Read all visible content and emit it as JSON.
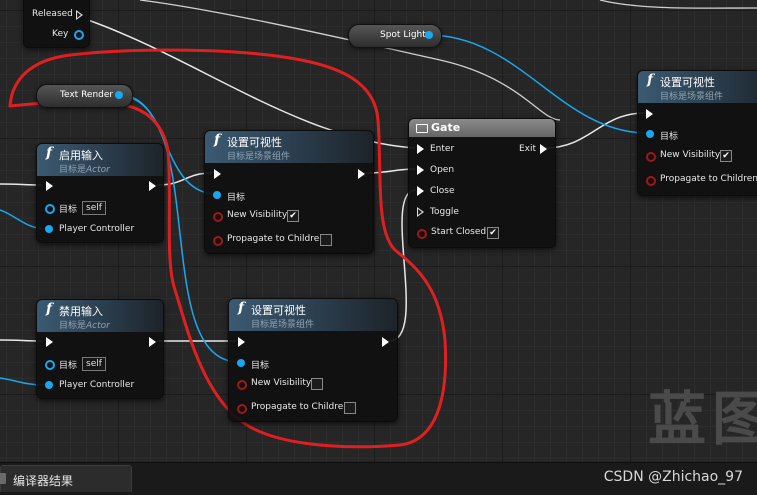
{
  "watermark": "蓝图",
  "nodes": {
    "input_key_node": {
      "released_label": "Released",
      "key_label": "Key"
    },
    "spot_light": {
      "label": "Spot Light"
    },
    "text_render": {
      "label": "Text Render"
    },
    "enable_input": {
      "title": "启用输入",
      "subtitle_prefix": "目标是",
      "subtitle_target": "Actor",
      "target_label": "目标",
      "self_value": "self",
      "player_controller_label": "Player Controller"
    },
    "disable_input": {
      "title": "禁用输入",
      "subtitle_prefix": "目标是",
      "subtitle_target": "Actor",
      "target_label": "目标",
      "self_value": "self",
      "player_controller_label": "Player Controller"
    },
    "set_visibility_1": {
      "title": "设置可视性",
      "subtitle": "目标是场景组件",
      "target_label": "目标",
      "new_visibility_label": "New Visibility",
      "new_visibility_checked": true,
      "propagate_label": "Propagate to Children",
      "propagate_checked": false
    },
    "set_visibility_2": {
      "title": "设置可视性",
      "subtitle": "目标是场景组件",
      "target_label": "目标",
      "new_visibility_label": "New Visibility",
      "new_visibility_checked": false,
      "propagate_label": "Propagate to Children",
      "propagate_checked": false
    },
    "set_visibility_3": {
      "title": "设置可视性",
      "subtitle": "目标是场景组件",
      "target_label": "目标",
      "new_visibility_label": "New Visibility",
      "new_visibility_checked": true,
      "propagate_label": "Propagate to Children",
      "propagate_checked": false
    },
    "gate": {
      "title": "Gate",
      "enter_label": "Enter",
      "exit_label": "Exit",
      "open_label": "Open",
      "close_label": "Close",
      "toggle_label": "Toggle",
      "start_closed_label": "Start Closed",
      "start_closed_checked": true
    }
  },
  "bottom_bar": {
    "tab_label": "编译器结果",
    "credit": "CSDN @Zhichao_97"
  },
  "colors": {
    "exec_wire": "#ffffff",
    "object_wire": "#19a7f0",
    "annotation": "#e02020",
    "bool_pin": "#a01818"
  }
}
